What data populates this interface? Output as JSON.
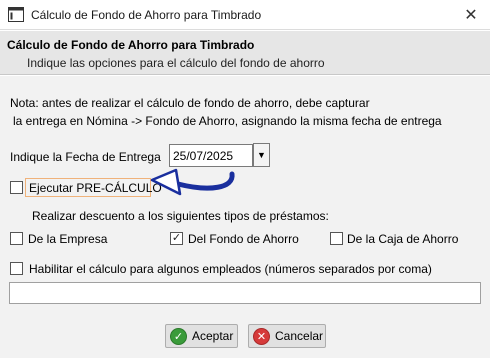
{
  "window": {
    "title": "Cálculo de Fondo de Ahorro para Timbrado"
  },
  "header": {
    "title": "Cálculo de Fondo de Ahorro para Timbrado",
    "subtitle": "Indique las opciones para el cálculo del fondo de ahorro"
  },
  "note": {
    "line1": "Nota: antes de realizar el cálculo de fondo de ahorro, debe capturar",
    "line2": "la entrega en Nómina -> Fondo de Ahorro, asignando la misma fecha de entrega"
  },
  "fecha": {
    "label": "Indique la Fecha de Entrega",
    "value": "25/07/2025"
  },
  "precalculo": {
    "label": "Ejecutar PRE-CÁLCULO",
    "checked": false
  },
  "descuento": {
    "label": "Realizar descuento a los siguientes tipos de préstamos:",
    "options": [
      {
        "label": "De la Empresa",
        "checked": false
      },
      {
        "label": "Del Fondo de Ahorro",
        "checked": true
      },
      {
        "label": "De la Caja de Ahorro",
        "checked": false
      }
    ]
  },
  "empleados": {
    "label": "Habilitar el cálculo para algunos empleados (números separados por coma)",
    "checked": false,
    "value": ""
  },
  "buttons": {
    "ok": "Aceptar",
    "cancel": "Cancelar"
  },
  "icons": {
    "app": "window-icon",
    "close": "close-icon",
    "dropdown": "chevron-down-icon",
    "check": "checkmark-icon",
    "ok": "check-circle-icon",
    "cancel": "x-circle-icon",
    "arrow": "annotation-arrow-icon"
  },
  "colors": {
    "arrow": "#1a2f9e",
    "highlight": "#f0b27a",
    "ok": "#3a9b3a",
    "cancel": "#d63a3a"
  }
}
